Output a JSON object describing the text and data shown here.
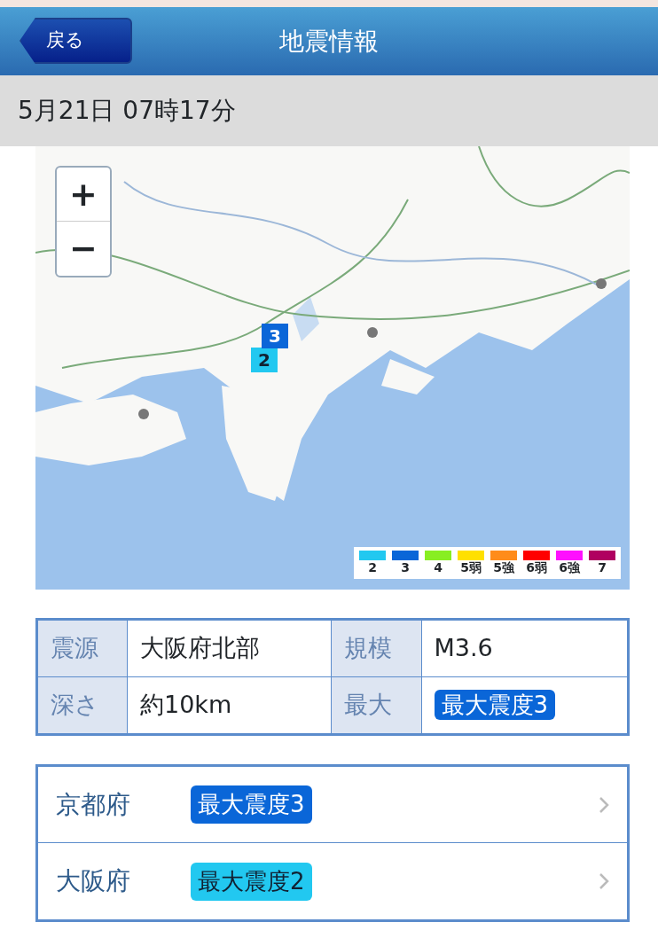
{
  "header": {
    "back_button": "戻る",
    "title": "地震情報"
  },
  "datetime": "5月21日 07時17分",
  "map": {
    "zoom_in": "+",
    "zoom_out": "−",
    "markers": [
      {
        "label": "2",
        "color": "#22c8f0"
      },
      {
        "label": "3",
        "color": "#0a66d8"
      }
    ],
    "legend": [
      {
        "label": "2",
        "color": "#22c8f0"
      },
      {
        "label": "3",
        "color": "#0a66d8"
      },
      {
        "label": "4",
        "color": "#88ee22"
      },
      {
        "label": "5弱",
        "color": "#ffe000"
      },
      {
        "label": "5強",
        "color": "#ff8c1a"
      },
      {
        "label": "6弱",
        "color": "#ff0000"
      },
      {
        "label": "6強",
        "color": "#ff10ff"
      },
      {
        "label": "7",
        "color": "#b00060"
      }
    ]
  },
  "info": [
    {
      "label": "震源",
      "value": "大阪府北部",
      "kind": "text"
    },
    {
      "label": "規模",
      "value": "M3.6",
      "kind": "text"
    },
    {
      "label": "深さ",
      "value": "約10km",
      "kind": "text"
    },
    {
      "label": "最大",
      "value": "最大震度3",
      "kind": "badge",
      "color": "#0a66d8"
    }
  ],
  "regions": [
    {
      "name": "京都府",
      "intensity": "最大震度3",
      "color": "#0a66d8"
    },
    {
      "name": "大阪府",
      "intensity": "最大震度2",
      "color": "#22c8f0"
    }
  ]
}
